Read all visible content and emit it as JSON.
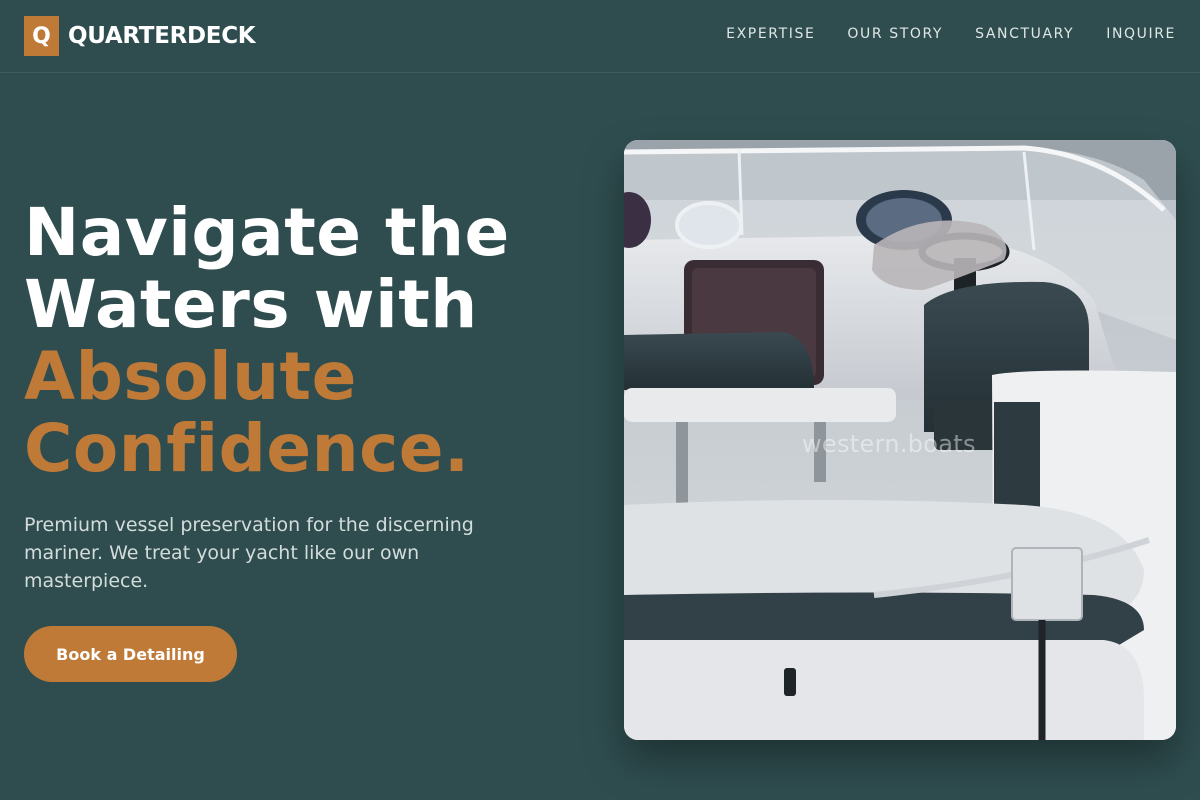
{
  "brand": {
    "mark": "Q",
    "name": "QUARTERDECK",
    "accent_color": "#c07a38",
    "background_color": "#2f4d4f"
  },
  "nav": {
    "items": [
      "EXPERTISE",
      "OUR STORY",
      "SANCTUARY",
      "INQUIRE"
    ]
  },
  "hero": {
    "title_lines": [
      "Navigate the",
      "Waters with"
    ],
    "title_accent_lines": [
      "Absolute",
      "Confidence."
    ],
    "subtitle": "Premium vessel preservation for the discerning mariner. We treat your yacht like our own masterpiece.",
    "cta_label": "Book a Detailing"
  },
  "image": {
    "subject": "boat-cockpit-photo",
    "watermark": "western.boats"
  }
}
